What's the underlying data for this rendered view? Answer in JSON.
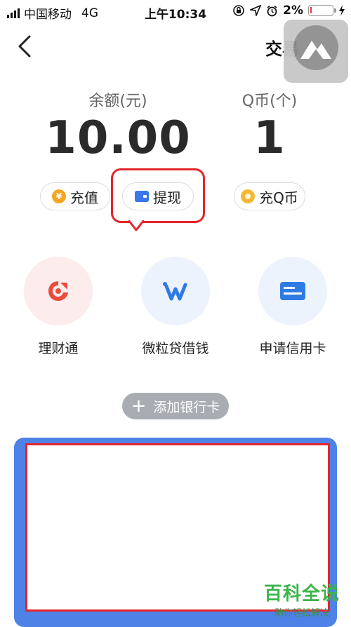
{
  "status_bar": {
    "carrier": "中国移动",
    "network": "4G",
    "time": "上午10:34",
    "battery": "2%"
  },
  "nav": {
    "title": "交易",
    "back_icon": "chevron-left-icon"
  },
  "balance": {
    "label": "余额(元)",
    "value": "10.00"
  },
  "qcoin": {
    "label": "Q币(个)",
    "value": "1"
  },
  "actions": {
    "recharge": "充值",
    "withdraw": "提现",
    "recharge_q": "充Q币",
    "recharge_coin_symbol": "¥"
  },
  "services": [
    {
      "label": "理财通",
      "icon": "licaitong-icon",
      "color": "#e94b3c"
    },
    {
      "label": "微粒贷借钱",
      "icon": "weilidai-icon",
      "color": "#2f7be5"
    },
    {
      "label": "申请信用卡",
      "icon": "credit-card-icon",
      "color": "#2f7be5"
    }
  ],
  "add_bank_label": "添加银行卡",
  "watermark": {
    "title": "百科全说",
    "subtitle": "助你轻松解决"
  },
  "colors": {
    "accent_blue": "#4f82e6",
    "highlight_red": "#e4262a",
    "coin_orange": "#f5a623"
  }
}
